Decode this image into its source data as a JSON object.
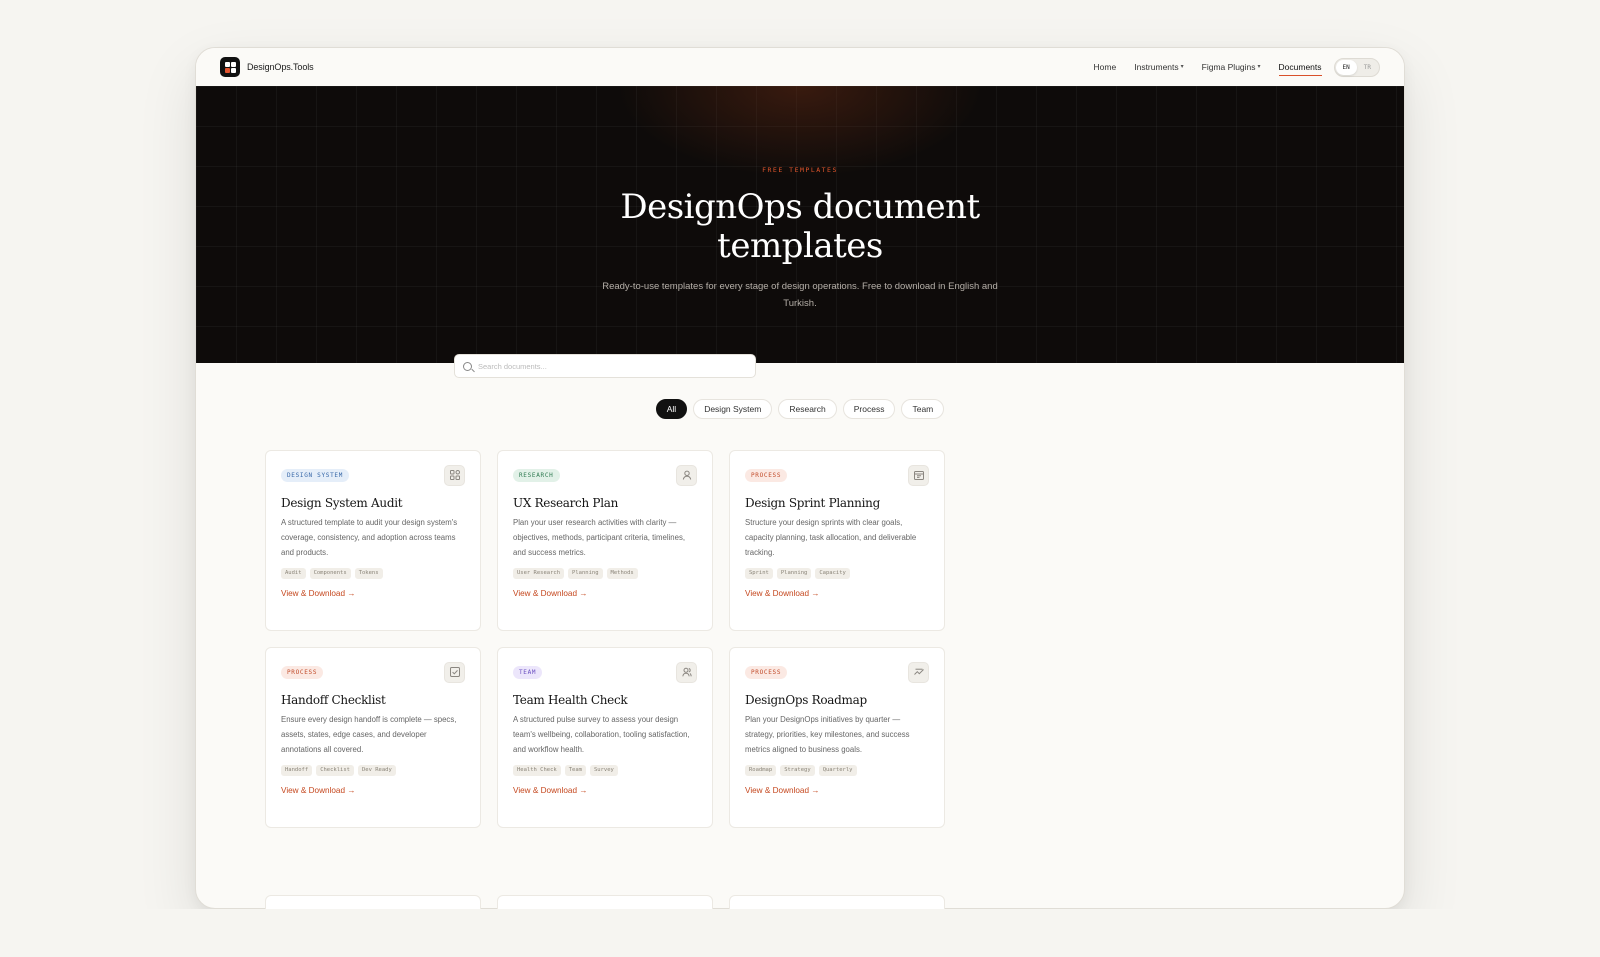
{
  "brand": {
    "name": "DesignOps.Tools"
  },
  "nav": {
    "home": "Home",
    "instruments": "Instruments",
    "figma_plugins": "Figma Plugins",
    "documents": "Documents",
    "lang_en": "EN",
    "lang_tr": "TR"
  },
  "hero": {
    "eyebrow": "FREE TEMPLATES",
    "title": "DesignOps document templates",
    "subtitle": "Ready-to-use templates for every stage of design operations. Free to download in English and Turkish."
  },
  "search": {
    "placeholder": "Search documents..."
  },
  "filters": [
    "All",
    "Design System",
    "Research",
    "Process",
    "Team"
  ],
  "active_filter": "All",
  "cards": [
    {
      "badge": "DESIGN SYSTEM",
      "icon": "components-icon",
      "title": "Design System Audit",
      "desc": "A structured template to audit your design system's coverage, consistency, and adoption across teams and products.",
      "tags": [
        "Audit",
        "Components",
        "Tokens"
      ],
      "link": "View & Download →"
    },
    {
      "badge": "RESEARCH",
      "icon": "user-icon",
      "title": "UX Research Plan",
      "desc": "Plan your user research activities with clarity — objectives, methods, participant criteria, timelines, and success metrics.",
      "tags": [
        "User Research",
        "Planning",
        "Methods"
      ],
      "link": "View & Download →"
    },
    {
      "badge": "PROCESS",
      "icon": "calendar-icon",
      "title": "Design Sprint Planning",
      "desc": "Structure your design sprints with clear goals, capacity planning, task allocation, and deliverable tracking.",
      "tags": [
        "Sprint",
        "Planning",
        "Capacity"
      ],
      "link": "View & Download →"
    },
    {
      "badge": "PROCESS",
      "icon": "checkbox-icon",
      "title": "Handoff Checklist",
      "desc": "Ensure every design handoff is complete — specs, assets, states, edge cases, and developer annotations all covered.",
      "tags": [
        "Handoff",
        "Checklist",
        "Dev Ready"
      ],
      "link": "View & Download →"
    },
    {
      "badge": "TEAM",
      "icon": "team-icon",
      "title": "Team Health Check",
      "desc": "A structured pulse survey to assess your design team's wellbeing, collaboration, tooling satisfaction, and workflow health.",
      "tags": [
        "Health Check",
        "Team",
        "Survey"
      ],
      "link": "View & Download →"
    },
    {
      "badge": "PROCESS",
      "icon": "trend-icon",
      "title": "DesignOps Roadmap",
      "desc": "Plan your DesignOps initiatives by quarter — strategy, priorities, key milestones, and success metrics aligned to business goals.",
      "tags": [
        "Roadmap",
        "Strategy",
        "Quarterly"
      ],
      "link": "View & Download →"
    }
  ]
}
